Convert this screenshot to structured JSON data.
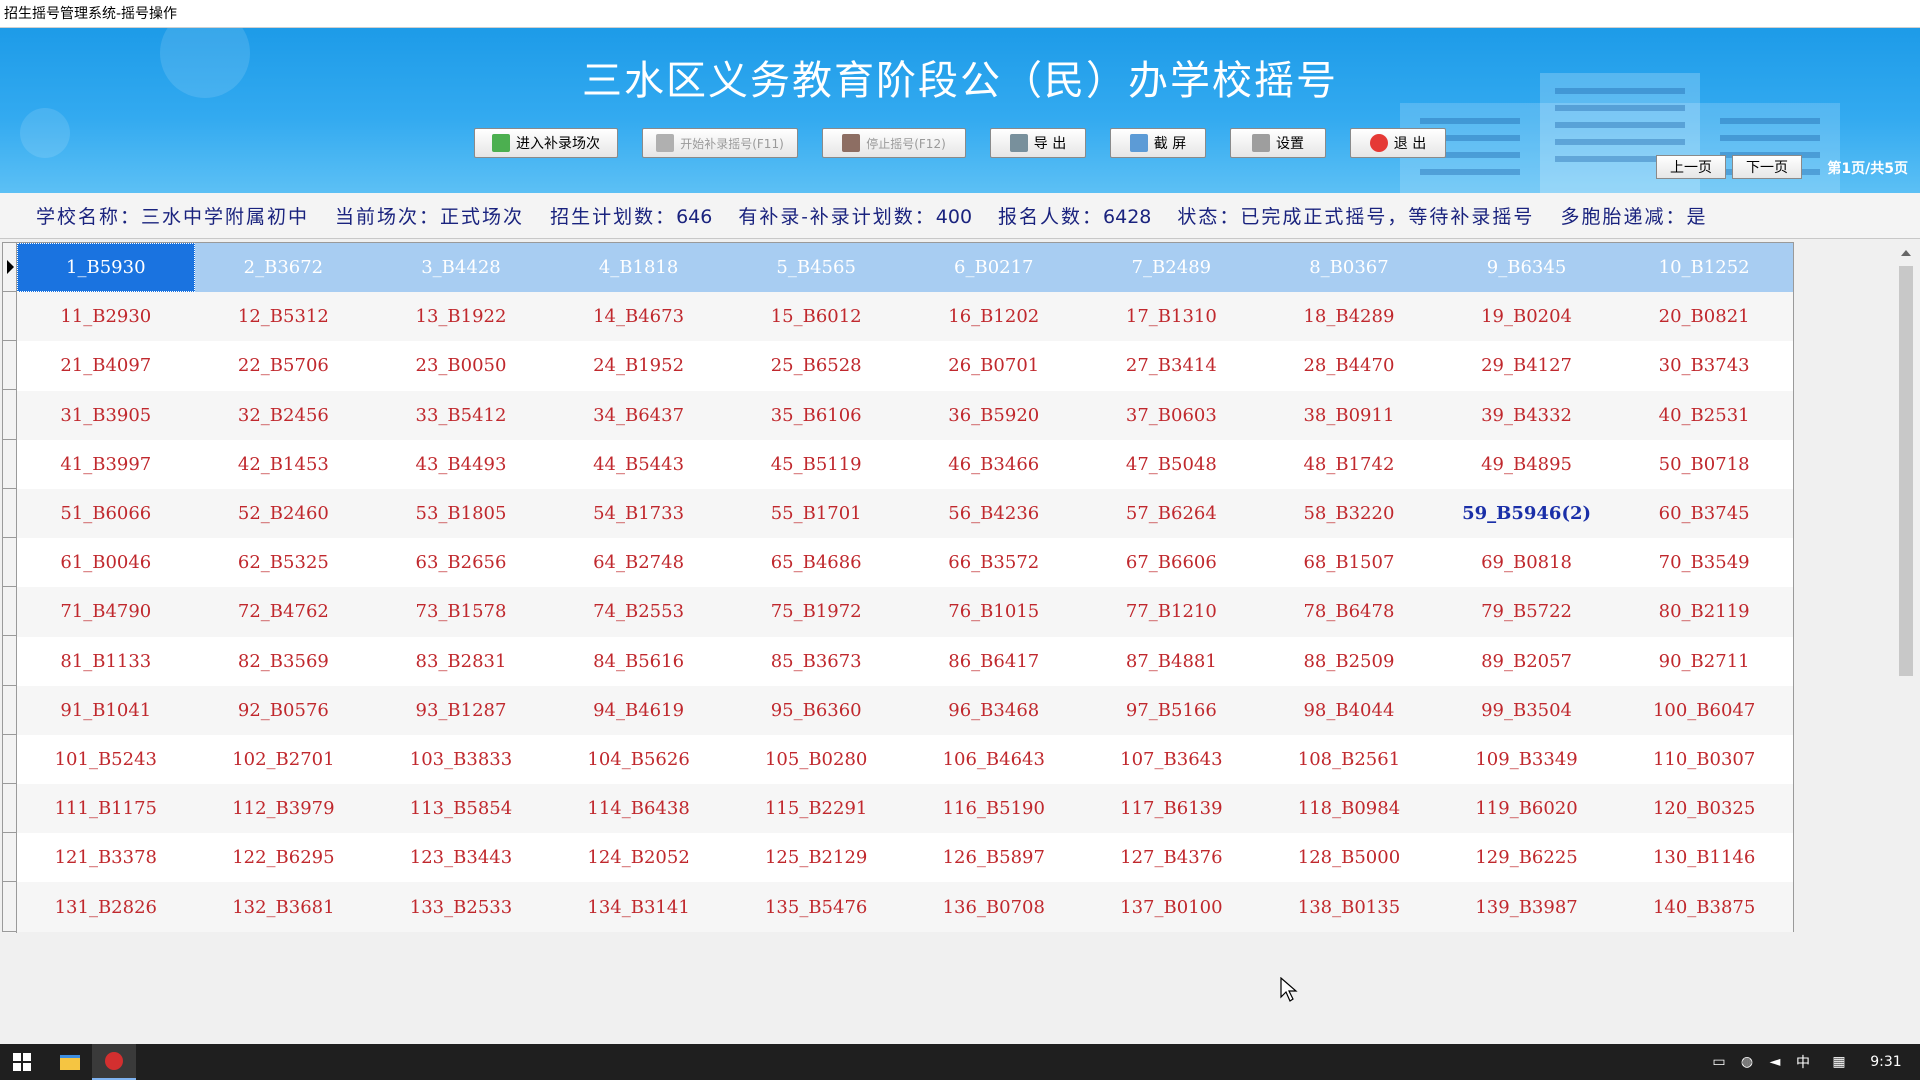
{
  "window": {
    "title": "招生摇号管理系统-摇号操作"
  },
  "banner": {
    "title": "三水区义务教育阶段公（民）办学校摇号"
  },
  "toolbar": {
    "enter_supplement": "进入补录场次",
    "start_supplement": "开始补录摇号(F11)",
    "stop_draw": "停止摇号(F12)",
    "export": "导 出",
    "screenshot": "截 屏",
    "settings": "设置",
    "exit": "退 出"
  },
  "pager": {
    "prev": "上一页",
    "next": "下一页",
    "info": "第1页/共5页"
  },
  "info": {
    "school_label": "学校名称：",
    "school_value": "三水中学附属初中",
    "session_label": "当前场次：",
    "session_value": "正式场次",
    "plan_label": "招生计划数：",
    "plan_value": "646",
    "supp_label": "有补录-补录计划数：",
    "supp_value": "400",
    "applicants_label": "报名人数：",
    "applicants_value": "6428",
    "status_label": "状态：",
    "status_value": "已完成正式摇号，等待补录摇号",
    "twins_label": "多胞胎递减：",
    "twins_value": "是"
  },
  "grid": {
    "rows": [
      [
        "1_B5930",
        "2_B3672",
        "3_B4428",
        "4_B1818",
        "5_B4565",
        "6_B0217",
        "7_B2489",
        "8_B0367",
        "9_B6345",
        "10_B1252"
      ],
      [
        "11_B2930",
        "12_B5312",
        "13_B1922",
        "14_B4673",
        "15_B6012",
        "16_B1202",
        "17_B1310",
        "18_B4289",
        "19_B0204",
        "20_B0821"
      ],
      [
        "21_B4097",
        "22_B5706",
        "23_B0050",
        "24_B1952",
        "25_B6528",
        "26_B0701",
        "27_B3414",
        "28_B4470",
        "29_B4127",
        "30_B3743"
      ],
      [
        "31_B3905",
        "32_B2456",
        "33_B5412",
        "34_B6437",
        "35_B6106",
        "36_B5920",
        "37_B0603",
        "38_B0911",
        "39_B4332",
        "40_B2531"
      ],
      [
        "41_B3997",
        "42_B1453",
        "43_B4493",
        "44_B5443",
        "45_B5119",
        "46_B3466",
        "47_B5048",
        "48_B1742",
        "49_B4895",
        "50_B0718"
      ],
      [
        "51_B6066",
        "52_B2460",
        "53_B1805",
        "54_B1733",
        "55_B1701",
        "56_B4236",
        "57_B6264",
        "58_B3220",
        "59_B5946(2)",
        "60_B3745"
      ],
      [
        "61_B0046",
        "62_B5325",
        "63_B2656",
        "64_B2748",
        "65_B4686",
        "66_B3572",
        "67_B6606",
        "68_B1507",
        "69_B0818",
        "70_B3549"
      ],
      [
        "71_B4790",
        "72_B4762",
        "73_B1578",
        "74_B2553",
        "75_B1972",
        "76_B1015",
        "77_B1210",
        "78_B6478",
        "79_B5722",
        "80_B2119"
      ],
      [
        "81_B1133",
        "82_B3569",
        "83_B2831",
        "84_B5616",
        "85_B3673",
        "86_B6417",
        "87_B4881",
        "88_B2509",
        "89_B2057",
        "90_B2711"
      ],
      [
        "91_B1041",
        "92_B0576",
        "93_B1287",
        "94_B4619",
        "95_B6360",
        "96_B3468",
        "97_B5166",
        "98_B4044",
        "99_B3504",
        "100_B6047"
      ],
      [
        "101_B5243",
        "102_B2701",
        "103_B3833",
        "104_B5626",
        "105_B0280",
        "106_B4643",
        "107_B3643",
        "108_B2561",
        "109_B3349",
        "110_B0307"
      ],
      [
        "111_B1175",
        "112_B3979",
        "113_B5854",
        "114_B6438",
        "115_B2291",
        "116_B5190",
        "117_B6139",
        "118_B0984",
        "119_B6020",
        "120_B0325"
      ],
      [
        "121_B3378",
        "122_B6295",
        "123_B3443",
        "124_B2052",
        "125_B2129",
        "126_B5897",
        "127_B4376",
        "128_B5000",
        "129_B6225",
        "130_B1146"
      ],
      [
        "131_B2826",
        "132_B3681",
        "133_B2533",
        "134_B3141",
        "135_B5476",
        "136_B0708",
        "137_B0100",
        "138_B0135",
        "139_B3987",
        "140_B3875"
      ]
    ]
  },
  "taskbar": {
    "ime": "中",
    "clock": "9:31"
  },
  "colors": {
    "banner": "#1d9be8",
    "cell_text": "#c0282d",
    "highlight_text": "#1a2fa8",
    "selected_bg": "#1a73e0"
  }
}
